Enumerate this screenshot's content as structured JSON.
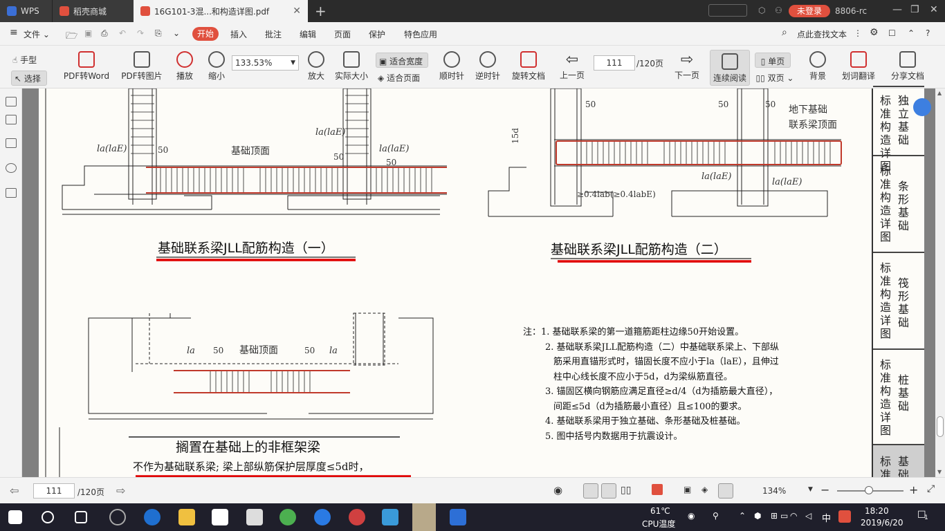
{
  "titlebar": {
    "tabs": [
      {
        "label": "WPS"
      },
      {
        "label": "稻壳商城"
      },
      {
        "label": "16G101-3混...和构造详图.pdf"
      }
    ],
    "login": "未登录",
    "user": "8806-rc"
  },
  "menubar": {
    "file": "文件",
    "items": [
      "开始",
      "插入",
      "批注",
      "编辑",
      "页面",
      "保护",
      "特色应用"
    ],
    "search": "点此查找文本"
  },
  "toolbar": {
    "hand": "手型",
    "select": "选择",
    "pdf2word": "PDF转Word",
    "pdf2img": "PDF转图片",
    "play": "播放",
    "zoomout": "缩小",
    "zoom_value": "133.53%",
    "zoomin": "放大",
    "actual": "实际大小",
    "fitwidth": "适合宽度",
    "fitpage": "适合页面",
    "cw": "顺时针",
    "ccw": "逆时针",
    "rotate": "旋转文档",
    "prev": "上一页",
    "page": "111",
    "total": "/120页",
    "next": "下一页",
    "continuous": "连续阅读",
    "single": "单页",
    "double": "双页",
    "bg": "背景",
    "translate": "划词翻译",
    "share": "分享文档"
  },
  "drawing": {
    "d1_title": "基础联系梁JLL配筋构造（一）",
    "d2_title": "基础联系梁JLL配筋构造（二）",
    "d3_title": "搁置在基础上的非框架梁",
    "d3_sub": "不作为基础联系梁; 梁上部纵筋保护层厚度≤5d时，",
    "lbl_top": "基础顶面",
    "lbl_top2": "基础顶面",
    "lbl_top3": "地下基础",
    "lbl_top4": "联系梁顶面",
    "la1": "la(laE)",
    "la2": "la(laE)",
    "la3": "la(laE)",
    "la4": "la(laE)",
    "la5": "la(laE)",
    "n50": "50",
    "d15": "15d",
    "anchor": "≥0.4lab(≥0.4labE)",
    "la_s": "la",
    "notes": [
      "注：1. 基础联系梁的第一道箍筋距柱边缘50开始设置。",
      "2. 基础联系梁JLL配筋构造（二）中基础联系梁上、下部纵",
      "筋采用直锚形式时，锚固长度不应小于la（laE），且伸过",
      "柱中心线长度不应小于5d，d为梁纵筋直径。",
      "3. 锚固区横向钢筋应满足直径≥d/4（d为插筋最大直径），",
      "间距≤5d（d为插筋最小直径）且≤100的要求。",
      "4. 基础联系梁用于独立基础、条形基础及桩基础。",
      "5. 图中括号内数据用于抗震设计。"
    ]
  },
  "sidetabs": [
    {
      "c1": "标准构造详图",
      "c2": "独立基础"
    },
    {
      "c1": "标准构造详图",
      "c2": "条形基础"
    },
    {
      "c1": "标准构造详图",
      "c2": "筏形基础"
    },
    {
      "c1": "标准构造详图",
      "c2": "桩基础"
    },
    {
      "c1": "标准",
      "c2": "基础"
    }
  ],
  "statusbar": {
    "page": "111",
    "total": "/120页",
    "zoom": "134%"
  },
  "taskbar": {
    "temp": "61℃",
    "temp_label": "CPU温度",
    "ime": "中",
    "time": "18:20",
    "date": "2019/6/20",
    "notif": "1"
  }
}
